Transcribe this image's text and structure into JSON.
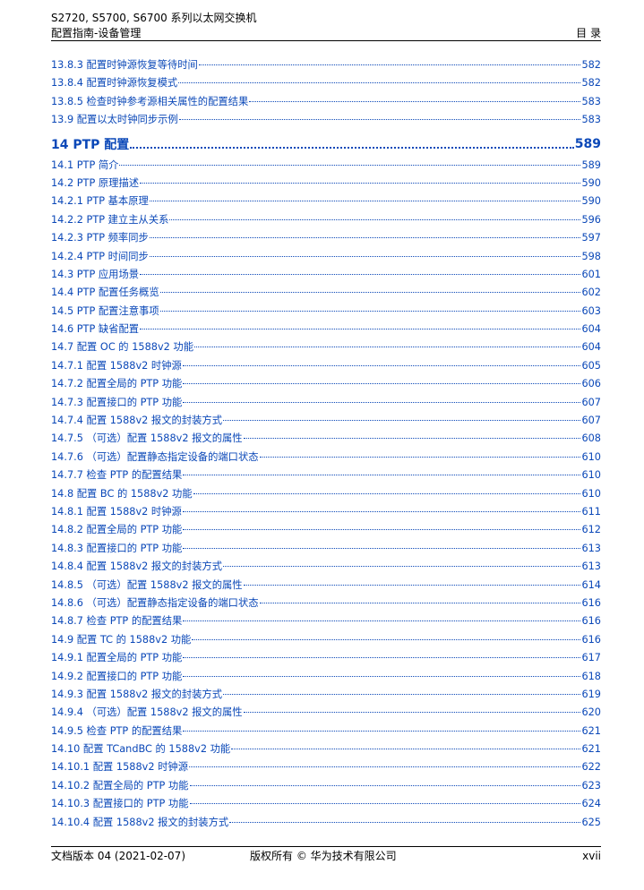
{
  "header": {
    "product_line": "S2720, S5700, S6700 系列以太网交换机",
    "guide_title": "配置指南-设备管理",
    "section_name": "目 录"
  },
  "toc": [
    {
      "title": "13.8.3 配置时钟源恢复等待时间",
      "page": "582"
    },
    {
      "title": "13.8.4 配置时钟源恢复模式",
      "page": "582"
    },
    {
      "title": "13.8.5 检查时钟参考源相关属性的配置结果",
      "page": "583"
    },
    {
      "title": "13.9 配置以太时钟同步示例",
      "page": "583"
    },
    {
      "title": "14 PTP 配置",
      "page": "589",
      "chapter": true
    },
    {
      "title": "14.1 PTP 简介",
      "page": "589"
    },
    {
      "title": "14.2 PTP 原理描述",
      "page": "590"
    },
    {
      "title": "14.2.1 PTP 基本原理",
      "page": "590"
    },
    {
      "title": "14.2.2 PTP 建立主从关系",
      "page": "596"
    },
    {
      "title": "14.2.3 PTP 频率同步",
      "page": "597"
    },
    {
      "title": "14.2.4 PTP 时间同步",
      "page": "598"
    },
    {
      "title": "14.3 PTP 应用场景",
      "page": "601"
    },
    {
      "title": "14.4 PTP 配置任务概览",
      "page": "602"
    },
    {
      "title": "14.5 PTP 配置注意事项",
      "page": "603"
    },
    {
      "title": "14.6 PTP 缺省配置",
      "page": "604"
    },
    {
      "title": "14.7 配置 OC 的 1588v2 功能",
      "page": "604"
    },
    {
      "title": "14.7.1 配置 1588v2 时钟源",
      "page": "605"
    },
    {
      "title": "14.7.2 配置全局的 PTP 功能",
      "page": "606"
    },
    {
      "title": "14.7.3 配置接口的 PTP 功能",
      "page": "607"
    },
    {
      "title": "14.7.4 配置 1588v2 报文的封装方式",
      "page": "607"
    },
    {
      "title": "14.7.5 （可选）配置 1588v2 报文的属性",
      "page": "608"
    },
    {
      "title": "14.7.6 （可选）配置静态指定设备的端口状态",
      "page": "610"
    },
    {
      "title": "14.7.7 检查 PTP 的配置结果",
      "page": "610"
    },
    {
      "title": "14.8 配置 BC 的 1588v2 功能",
      "page": "610"
    },
    {
      "title": "14.8.1 配置 1588v2 时钟源",
      "page": "611"
    },
    {
      "title": "14.8.2 配置全局的 PTP 功能",
      "page": "612"
    },
    {
      "title": "14.8.3 配置接口的 PTP 功能",
      "page": "613"
    },
    {
      "title": "14.8.4 配置 1588v2 报文的封装方式",
      "page": "613"
    },
    {
      "title": "14.8.5 （可选）配置 1588v2 报文的属性",
      "page": "614"
    },
    {
      "title": "14.8.6 （可选）配置静态指定设备的端口状态",
      "page": "616"
    },
    {
      "title": "14.8.7 检查 PTP 的配置结果",
      "page": "616"
    },
    {
      "title": "14.9 配置 TC 的 1588v2 功能",
      "page": "616"
    },
    {
      "title": "14.9.1 配置全局的 PTP 功能",
      "page": "617"
    },
    {
      "title": "14.9.2 配置接口的 PTP 功能",
      "page": "618"
    },
    {
      "title": "14.9.3 配置 1588v2 报文的封装方式",
      "page": "619"
    },
    {
      "title": "14.9.4 （可选）配置 1588v2 报文的属性",
      "page": "620"
    },
    {
      "title": "14.9.5 检查 PTP 的配置结果",
      "page": "621"
    },
    {
      "title": "14.10 配置 TCandBC 的 1588v2 功能",
      "page": "621"
    },
    {
      "title": "14.10.1 配置 1588v2 时钟源",
      "page": "622"
    },
    {
      "title": "14.10.2 配置全局的 PTP 功能",
      "page": "623"
    },
    {
      "title": "14.10.3 配置接口的 PTP 功能",
      "page": "624"
    },
    {
      "title": "14.10.4 配置 1588v2 报文的封装方式",
      "page": "625"
    }
  ],
  "footer": {
    "doc_version": "文档版本 04 (2021-02-07)",
    "copyright": "版权所有 © 华为技术有限公司",
    "page_number": "xvii"
  },
  "colors": {
    "link": "#0b48b8",
    "text": "#000000"
  }
}
